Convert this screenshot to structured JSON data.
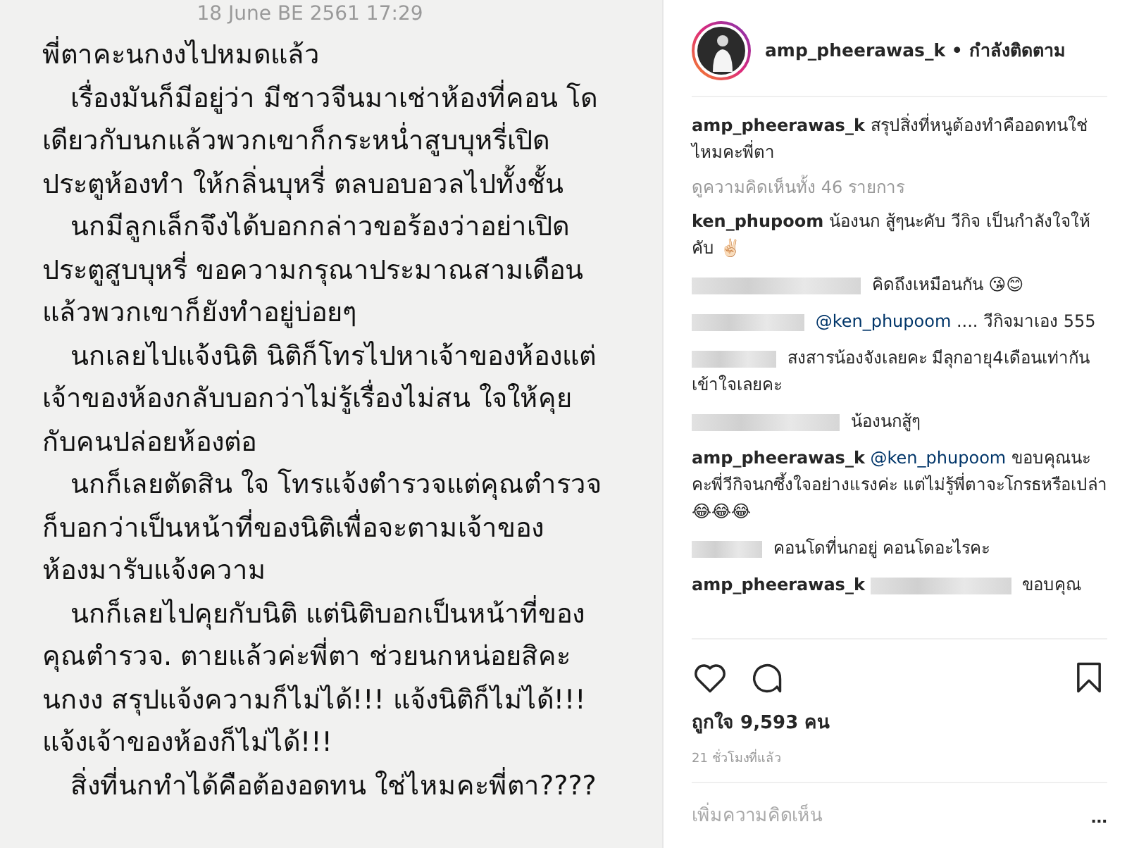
{
  "note": {
    "date": "18 June BE 2561 17:29",
    "paragraphs": [
      {
        "lines": [
          "พี่ตาคะนกงงไปหมดแล้ว"
        ]
      },
      {
        "lines": [
          "เรื่องมันก็มีอยู่ว่า มีชาวจีนมาเช่าห้องที่คอน โด",
          "เดียวกับนกแล้วพวกเขาก็กระหน่ำสูบบุหรี่เปิด",
          "ประตูห้องทำ ให้กลิ่นบุหรี่ ตลบอบอวลไปทั้งชั้น"
        ]
      },
      {
        "lines": [
          "นกมีลูกเล็กจึงได้บอกกล่าวขอร้องว่าอย่าเปิด",
          "ประตูสูบบุหรี่ ขอความกรุณาประมาณสามเดือน",
          "แล้วพวกเขาก็ยังทำอยู่บ่อยๆ"
        ]
      },
      {
        "lines": [
          "นกเลยไปแจ้งนิติ นิติก็โทรไปหาเจ้าของห้องแต่",
          "เจ้าของห้องกลับบอกว่าไม่รู้เรื่องไม่สน ใจให้คุย",
          "กับคนปล่อยห้องต่อ"
        ]
      },
      {
        "lines": [
          "นกก็เลยตัดสิน ใจ โทรแจ้งตำรวจแต่คุณตำรวจ",
          "ก็บอกว่าเป็นหน้าที่ของนิติเพื่อจะตามเจ้าของ",
          "ห้องมารับแจ้งความ"
        ]
      },
      {
        "lines": [
          "นกก็เลยไปคุยกับนิติ แต่นิติบอกเป็นหน้าที่ของ",
          "คุณตำรวจ.  ตายแล้วค่ะพี่ตา ช่วยนกหน่อยสิคะ",
          "นกงง สรุปแจ้งความก็ไม่ได้!!! แจ้งนิติก็ไม่ได้!!!",
          "แจ้งเจ้าของห้องก็ไม่ได้!!!"
        ]
      },
      {
        "lines": [
          "สิ่งที่นกทำได้คือต้องอดทน ใช่ไหมคะพี่ตา????"
        ]
      }
    ]
  },
  "post": {
    "username": "amp_pheerawas_k",
    "separator": "•",
    "follow_status": "กำลังติดตาม",
    "caption": {
      "user": "amp_pheerawas_k",
      "text": "สรุปสิ่งที่หนูต้องทำคืออดทนใช่ไหมคะพี่ตา"
    },
    "view_all": "ดูความคิดเห็นทั้ง 46 รายการ",
    "comments": [
      {
        "kind": "named",
        "user": "ken_phupoom",
        "text": "น้องนก สู้ๆนะคับ วีกิจ เป็นกำลังใจให้คับ ✌🏻"
      },
      {
        "kind": "hidden_user",
        "text": "คิดถึงเหมือนกัน 😘😊"
      },
      {
        "kind": "hidden_user",
        "mention": "@ken_phupoom",
        "text": ".... วีกิจมาเอง 555"
      },
      {
        "kind": "hidden_user",
        "text": "สงสารน้องจังเลยคะ มีลุกอายุ4เดือนเท่ากัน เข้าใจเลยคะ"
      },
      {
        "kind": "hidden_user",
        "text": "น้องนกสู้ๆ"
      },
      {
        "kind": "named",
        "user": "amp_pheerawas_k",
        "mention": "@ken_phupoom",
        "text": "ขอบคุณนะคะพี่วีกิจนกซึ้งใจอย่างแรงค่ะ แต่ไม่รู้พี่ตาจะโกรธหรือเปล่า😂😂😂"
      },
      {
        "kind": "hidden_user",
        "text": "คอนโดที่นกอยู่ คอนโดอะไรคะ"
      },
      {
        "kind": "hidden_mention",
        "user": "amp_pheerawas_k",
        "text": "ขอบคุณ"
      }
    ],
    "likes": "ถูกใจ 9,593 คน",
    "time": "21 ชั่วโมงที่แล้ว",
    "add_comment": {
      "placeholder": "เพิ่มความคิดเห็น"
    },
    "more": "..."
  }
}
